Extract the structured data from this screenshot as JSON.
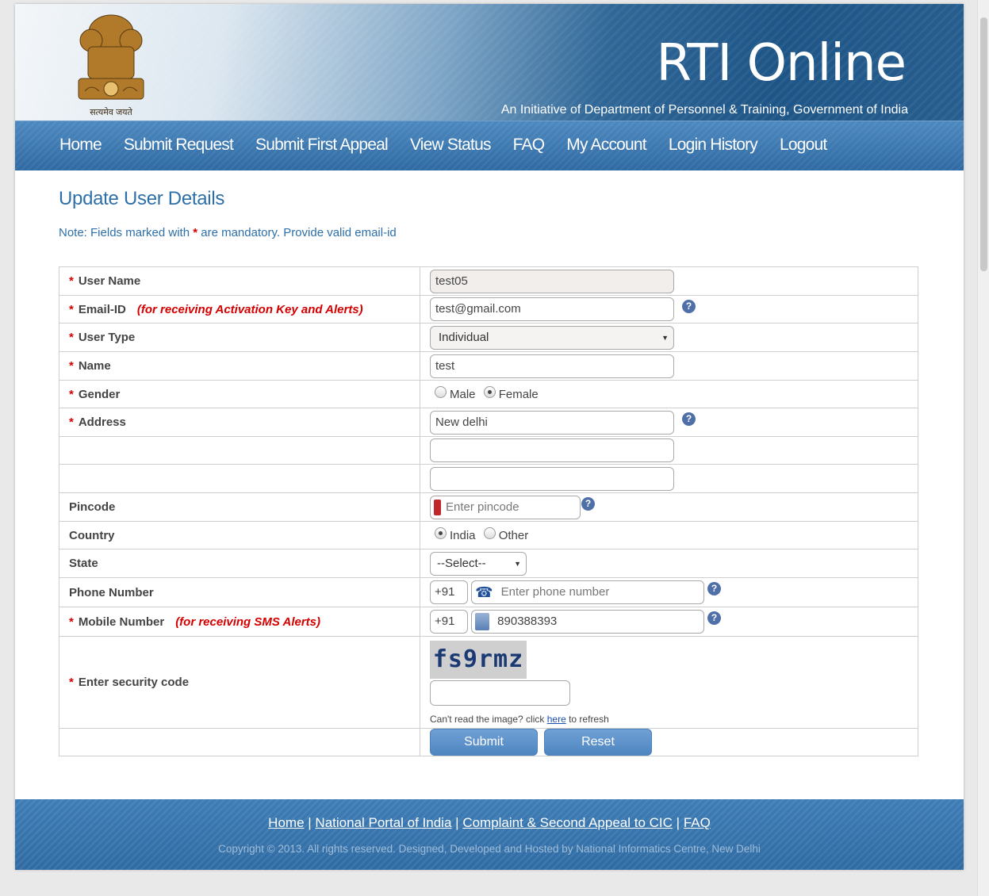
{
  "header": {
    "title": "RTI Online",
    "subtitle": "An Initiative of Department of Personnel & Training, Government of India",
    "emblem_text": "सत्यमेव जयते"
  },
  "nav": [
    "Home",
    "Submit Request",
    "Submit First Appeal",
    "View Status",
    "FAQ",
    "My Account",
    "Login History",
    "Logout"
  ],
  "page_title": "Update User Details",
  "note": {
    "before": "Note: Fields marked with",
    "star": "*",
    "after": "are mandatory. Provide valid email-id"
  },
  "form": {
    "required_mark": "*",
    "help_glyph": "?",
    "user_name": {
      "label": "User Name",
      "value": "test05"
    },
    "email": {
      "label": "Email-ID",
      "hint": "(for receiving Activation Key and Alerts)",
      "value": "test@gmail.com"
    },
    "user_type": {
      "label": "User Type",
      "value": "Individual"
    },
    "name": {
      "label": "Name",
      "value": "test"
    },
    "gender": {
      "label": "Gender",
      "options": [
        "Male",
        "Female"
      ],
      "selected": "Female"
    },
    "address": {
      "label": "Address",
      "line1": "New delhi",
      "line2": "",
      "line3": ""
    },
    "pincode": {
      "label": "Pincode",
      "placeholder": "Enter pincode"
    },
    "country": {
      "label": "Country",
      "options": [
        "India",
        "Other"
      ],
      "selected": "India"
    },
    "state": {
      "label": "State",
      "value": "--Select--"
    },
    "phone": {
      "label": "Phone Number",
      "code": "+91",
      "placeholder": "Enter phone number"
    },
    "mobile": {
      "label": "Mobile Number",
      "hint": "(for receiving SMS Alerts)",
      "code": "+91",
      "value": "890388393"
    },
    "security": {
      "label": "Enter security code",
      "captcha": "fs9rmz",
      "refresh_before": "Can't read the image? click",
      "refresh_link": "here",
      "refresh_after": "to refresh"
    },
    "submit_label": "Submit",
    "reset_label": "Reset"
  },
  "footer": {
    "links": [
      "Home",
      "National Portal of India",
      "Complaint & Second Appeal to CIC",
      "FAQ"
    ],
    "separator": "|",
    "copyright": "Copyright © 2013. All rights reserved. Designed, Developed and Hosted by National Informatics Centre, New Delhi"
  }
}
